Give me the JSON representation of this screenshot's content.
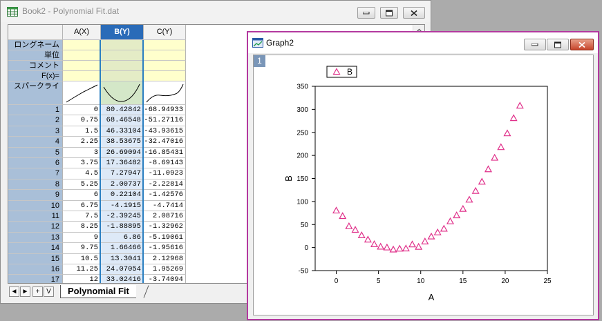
{
  "workbook": {
    "title": "Book2 - Polynomial Fit.dat",
    "columns": [
      "A(X)",
      "B(Y)",
      "C(Y)"
    ],
    "meta_labels": [
      "ロングネーム",
      "単位",
      "コメント",
      "F(x)=",
      "スパークライ"
    ],
    "rows": [
      {
        "n": "1",
        "a": "0",
        "b": "80.42842",
        "c": "-68.94933"
      },
      {
        "n": "2",
        "a": "0.75",
        "b": "68.46548",
        "c": "-51.27116"
      },
      {
        "n": "3",
        "a": "1.5",
        "b": "46.33104",
        "c": "-43.93615"
      },
      {
        "n": "4",
        "a": "2.25",
        "b": "38.53675",
        "c": "-32.47016"
      },
      {
        "n": "5",
        "a": "3",
        "b": "26.69094",
        "c": "-16.85431"
      },
      {
        "n": "6",
        "a": "3.75",
        "b": "17.36482",
        "c": "-8.69143"
      },
      {
        "n": "7",
        "a": "4.5",
        "b": "7.27947",
        "c": "-11.0923"
      },
      {
        "n": "8",
        "a": "5.25",
        "b": "2.00737",
        "c": "-2.22814"
      },
      {
        "n": "9",
        "a": "6",
        "b": "0.22104",
        "c": "-1.42576"
      },
      {
        "n": "10",
        "a": "6.75",
        "b": "-4.1915",
        "c": "-4.7414"
      },
      {
        "n": "11",
        "a": "7.5",
        "b": "-2.39245",
        "c": "2.08716"
      },
      {
        "n": "12",
        "a": "8.25",
        "b": "-1.88895",
        "c": "-1.32962"
      },
      {
        "n": "13",
        "a": "9",
        "b": "6.86",
        "c": "-5.19061"
      },
      {
        "n": "14",
        "a": "9.75",
        "b": "1.66466",
        "c": "-1.95616"
      },
      {
        "n": "15",
        "a": "10.5",
        "b": "13.3041",
        "c": "2.12968"
      },
      {
        "n": "16",
        "a": "11.25",
        "b": "24.07054",
        "c": "1.95269"
      },
      {
        "n": "17",
        "a": "12",
        "b": "33.02416",
        "c": "-3.74094"
      }
    ],
    "sheet_tab": "Polynomial Fit",
    "nav_buttons": [
      "◄",
      "►",
      "+",
      "V"
    ]
  },
  "graph": {
    "title": "Graph2",
    "layer": "1",
    "legend": "B",
    "accent": "#e0308a"
  },
  "chart_data": {
    "type": "scatter",
    "xlabel": "A",
    "ylabel": "B",
    "xlim": [
      -2.5,
      25
    ],
    "ylim": [
      -50,
      350
    ],
    "xticks": [
      "0",
      "5",
      "10",
      "15",
      "20",
      "25"
    ],
    "yticks": [
      "-50",
      "0",
      "50",
      "100",
      "150",
      "200",
      "250",
      "300",
      "350"
    ],
    "legend_position": "top-left",
    "series": [
      {
        "name": "B",
        "marker": "open-triangle",
        "color": "#e0308a",
        "x": [
          0,
          0.75,
          1.5,
          2.25,
          3,
          3.75,
          4.5,
          5.25,
          6,
          6.75,
          7.5,
          8.25,
          9,
          9.75,
          10.5,
          11.25,
          12,
          12.75,
          13.5,
          14.25,
          15,
          15.75,
          16.5,
          17.25,
          18,
          18.75,
          19.5,
          20.25,
          21,
          21.75
        ],
        "y": [
          80.43,
          68.47,
          46.33,
          38.54,
          26.69,
          17.36,
          7.28,
          2.01,
          0.22,
          -4.19,
          -2.39,
          -1.89,
          6.86,
          1.66,
          13.3,
          24.07,
          33.02,
          41,
          57,
          70,
          84,
          104,
          123,
          143,
          170,
          195,
          218,
          248,
          281,
          308
        ]
      }
    ]
  }
}
